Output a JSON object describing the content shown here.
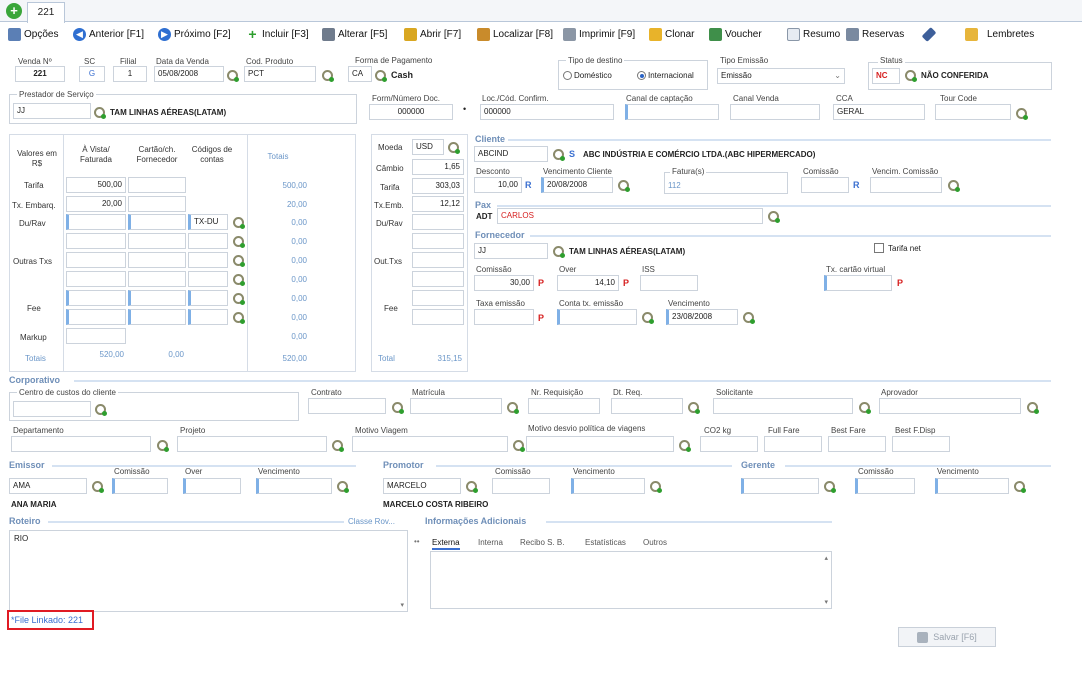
{
  "tabs": {
    "active_label": "221"
  },
  "toolbar": {
    "opcoes": "Opções",
    "anterior": "Anterior [F1]",
    "proximo": "Próximo [F2]",
    "incluir": "Incluir [F3]",
    "alterar": "Alterar [F5]",
    "abrir": "Abrir [F7]",
    "localizar": "Localizar [F8]",
    "imprimir": "Imprimir [F9]",
    "clonar": "Clonar",
    "voucher": "Voucher",
    "resumo": "Resumo",
    "reservas": "Reservas",
    "lembretes": "Lembretes"
  },
  "header": {
    "venda_label": "Venda Nº",
    "venda_value": "221",
    "sc_label": "SC",
    "sc_value": "G",
    "filial_label": "Filial",
    "filial_value": "1",
    "data_venda_label": "Data da Venda",
    "data_venda_value": "05/08/2008",
    "cod_produto_label": "Cod. Produto",
    "cod_produto_value": "PCT",
    "forma_pag_label": "Forma de Pagamento",
    "forma_pag_code": "CA",
    "forma_pag_name": "Cash",
    "tipo_destino_label": "Tipo de destino",
    "domestico": "Doméstico",
    "internacional": "Internacional",
    "tipo_emissao_label": "Tipo Emissão",
    "tipo_emissao_value": "Emissão",
    "status_label": "Status",
    "status_code": "NC",
    "status_value": "NÃO CONFERIDA",
    "prestador_label": "Prestador de Serviço",
    "prestador_code": "JJ",
    "prestador_name": "TAM LINHAS AÉREAS(LATAM)",
    "form_doc_label": "Form/Número Doc.",
    "form_doc_value": "000000",
    "loc_label": "Loc./Cód. Confirm.",
    "loc_value": "000000",
    "canal_capt_label": "Canal de captação",
    "canal_venda_label": "Canal Venda",
    "cca_label": "CCA",
    "cca_value": "GERAL",
    "tour_code_label": "Tour Code"
  },
  "values_grid": {
    "col_valores": "Valores em R$",
    "col_avista": "À Vista/ Faturada",
    "col_cartao": "Cartão/ch. Fornecedor",
    "col_codigos": "Códigos de contas",
    "col_totais": "Totais",
    "row_tarifa": "Tarifa",
    "row_txemb": "Tx. Embarq.",
    "row_du": "Du/Rav",
    "row_outras": "Outras Txs",
    "row_fee": "Fee",
    "row_markup": "Markup",
    "row_totais": "Totais",
    "tarifa_avista": "500,00",
    "txemb_avista": "20,00",
    "codigo_du": "TX-DU",
    "tot_tarifa": "500,00",
    "tot_txemb": "20,00",
    "tot_du": "0,00",
    "tot_o1": "0,00",
    "tot_o2": "0,00",
    "tot_o3": "0,00",
    "tot_fee1": "0,00",
    "tot_fee2": "0,00",
    "tot_markup": "0,00",
    "sum_avista": "520,00",
    "sum_cartao": "0,00",
    "sum_total": "520,00"
  },
  "currency": {
    "moeda_label": "Moeda",
    "moeda_value": "USD",
    "cambio_label": "Câmbio",
    "cambio_value": "1,65",
    "tarifa_label": "Tarifa",
    "tarifa_value": "303,03",
    "txemb_label": "Tx.Emb.",
    "txemb_value": "12,12",
    "du_label": "Du/Rav",
    "out_label": "Out.Txs",
    "fee_label": "Fee",
    "total_label": "Total",
    "total_value": "315,15"
  },
  "cliente": {
    "section": "Cliente",
    "code": "ABCIND",
    "name": "ABC INDÚSTRIA E COMÉRCIO LTDA.(ABC HIPERMERCADO)",
    "desconto_label": "Desconto",
    "desconto_value": "10,00",
    "venc_label": "Vencimento Cliente",
    "venc_value": "20/08/2008",
    "fatura_label": "Fatura(s)",
    "fatura_value": "112",
    "comissao_label": "Comissão",
    "venc_comissao_label": "Vencim. Comissão"
  },
  "pax": {
    "section": "Pax",
    "type": "ADT",
    "name": "CARLOS"
  },
  "fornecedor": {
    "section": "Fornecedor",
    "code": "JJ",
    "name": "TAM LINHAS AÉREAS(LATAM)",
    "tarifa_net": "Tarifa net",
    "comissao_label": "Comissão",
    "comissao_value": "30,00",
    "over_label": "Over",
    "over_value": "14,10",
    "iss_label": "ISS",
    "tx_cartao_label": "Tx. cartão virtual",
    "taxa_emissao_label": "Taxa emissão",
    "conta_tx_label": "Conta tx. emissão",
    "venc_label": "Vencimento",
    "venc_value": "23/08/2008"
  },
  "corporativo": {
    "section": "Corporativo",
    "centro_custo": "Centro de custos do cliente",
    "contrato": "Contrato",
    "matricula": "Matrícula",
    "requisicao": "Nr. Requisição",
    "dt_req": "Dt. Req.",
    "solicitante": "Solicitante",
    "aprovador": "Aprovador",
    "departamento": "Departamento",
    "projeto": "Projeto",
    "motivo_viagem": "Motivo Viagem",
    "motivo_desvio": "Motivo desvio política de viagens",
    "co2": "CO2 kg",
    "full_fare": "Full Fare",
    "best_fare": "Best Fare",
    "best_fdisp": "Best F.Disp"
  },
  "emissor": {
    "section": "Emissor",
    "comissao": "Comissão",
    "over": "Over",
    "vencimento": "Vencimento",
    "code": "AMA",
    "name": "ANA MARIA"
  },
  "promotor": {
    "section": "Promotor",
    "comissao": "Comissão",
    "vencimento": "Vencimento",
    "code": "MARCELO",
    "name": "MARCELO COSTA RIBEIRO"
  },
  "gerente": {
    "section": "Gerente",
    "comissao": "Comissão",
    "vencimento": "Vencimento"
  },
  "roteiro": {
    "section": "Roteiro",
    "classe_link": "Classe Rov...",
    "value": "RIO"
  },
  "info_adicionais": {
    "section": "Informações Adicionais",
    "tabs": [
      "Externa",
      "Interna",
      "Recibo S. B.",
      "Estatísticas",
      "Outros"
    ]
  },
  "footer": {
    "file_linkado": "*File Linkado: 221",
    "salvar": "Salvar [F6]"
  }
}
